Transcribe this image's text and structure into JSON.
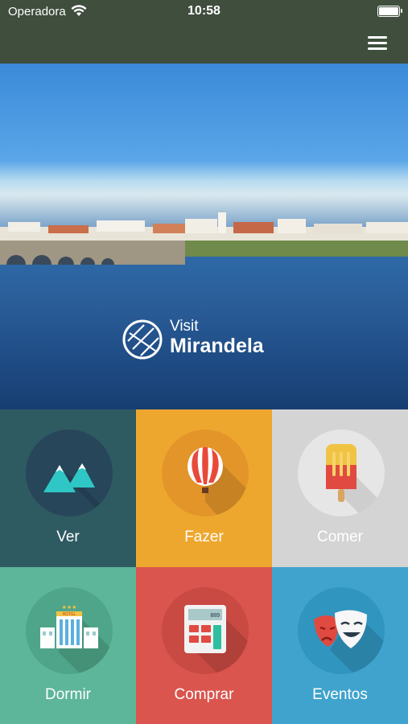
{
  "status_bar": {
    "carrier": "Operadora",
    "time": "10:58"
  },
  "hero": {
    "brand_line1": "Visit",
    "brand_line2": "Mirandela"
  },
  "tiles": [
    {
      "label": "Ver",
      "icon": "mountains-icon",
      "color": "#2e5a62"
    },
    {
      "label": "Fazer",
      "icon": "hot-air-balloon-icon",
      "color": "#eea72e"
    },
    {
      "label": "Comer",
      "icon": "popsicle-icon",
      "color": "#d4d4d4"
    },
    {
      "label": "Dormir",
      "icon": "hotel-icon",
      "color": "#5db59a"
    },
    {
      "label": "Comprar",
      "icon": "calculator-icon",
      "color": "#d9554d"
    },
    {
      "label": "Eventos",
      "icon": "theater-masks-icon",
      "color": "#3fa3cd"
    }
  ]
}
